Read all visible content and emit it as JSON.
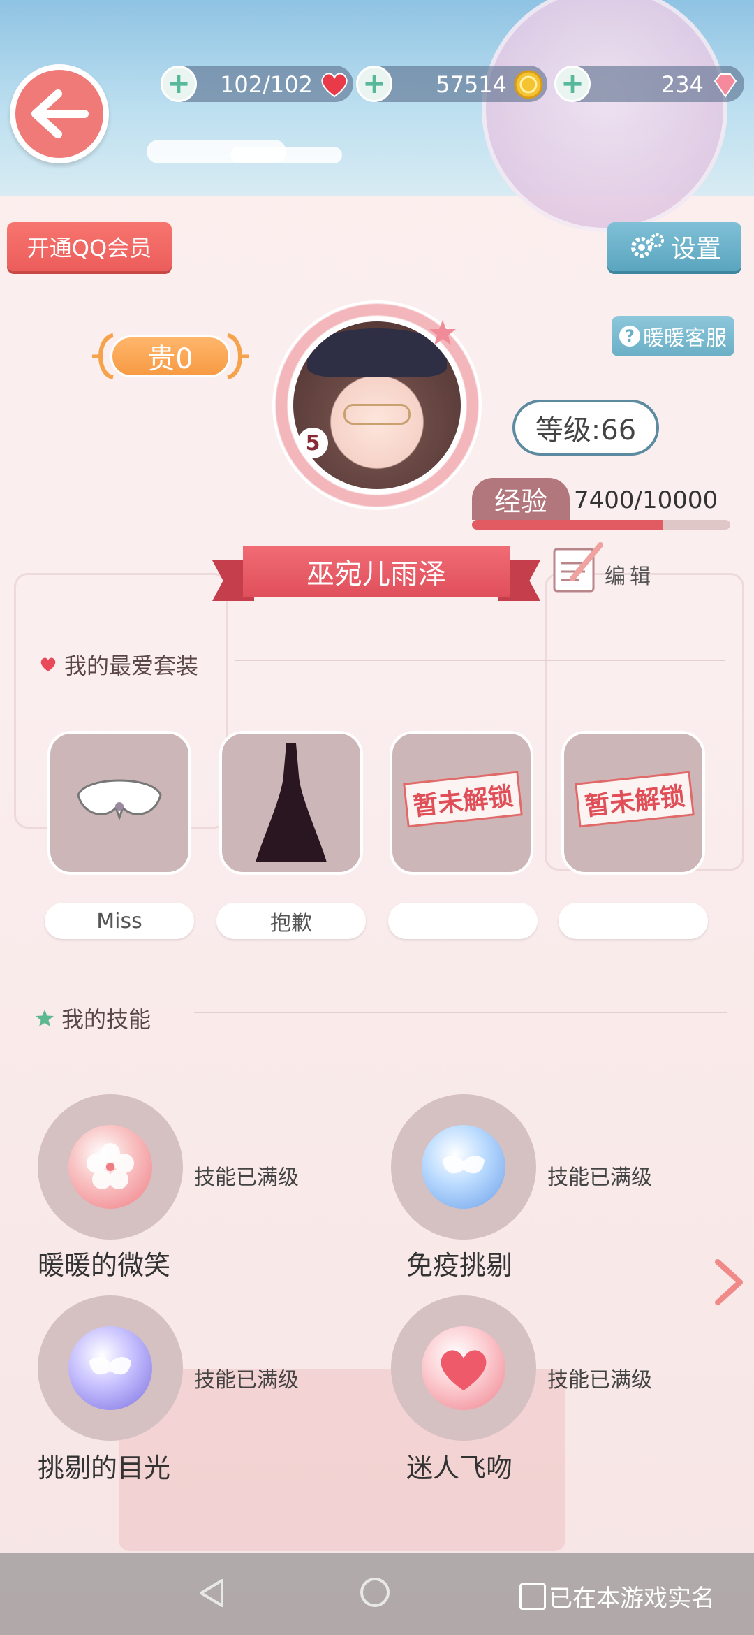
{
  "status_bar": {
    "stamina": "102/102",
    "gold": "57514",
    "diamonds": "234"
  },
  "buttons": {
    "qq_member": "开通QQ会员",
    "settings": "设置",
    "customer_service": "暖暖客服",
    "edit": "编辑"
  },
  "profile": {
    "noble": "贵0",
    "level": "等级:66",
    "exp_label": "经验",
    "exp_value": "7400/10000",
    "exp_fraction": 0.74,
    "name": "巫宛儿雨泽",
    "avatar_badge": "5"
  },
  "favorites": {
    "title": "我的最爱套装",
    "items": [
      {
        "name": "Miss",
        "locked": false,
        "icon": "collar-icon"
      },
      {
        "name": "抱歉",
        "locked": false,
        "icon": "dress-icon"
      },
      {
        "name": "",
        "locked": true,
        "locked_label": "暂未解锁"
      },
      {
        "name": "",
        "locked": true,
        "locked_label": "暂未解锁"
      }
    ]
  },
  "skills": {
    "title": "我的技能",
    "items": [
      {
        "name": "暖暖的微笑",
        "state": "技能已满级",
        "icon": "sakura-orb-icon"
      },
      {
        "name": "免疫挑剔",
        "state": "技能已满级",
        "icon": "winged-mask-icon"
      },
      {
        "name": "挑剔的目光",
        "state": "技能已满级",
        "icon": "mask-orb-icon"
      },
      {
        "name": "迷人飞吻",
        "state": "技能已满级",
        "icon": "heart-orb-icon"
      }
    ]
  },
  "navbar": {
    "real_name": "已在本游戏实名"
  },
  "colors": {
    "accent_red": "#ec5d5b",
    "accent_blue": "#5ba5bf",
    "card_bg": "#cdb6b8"
  }
}
